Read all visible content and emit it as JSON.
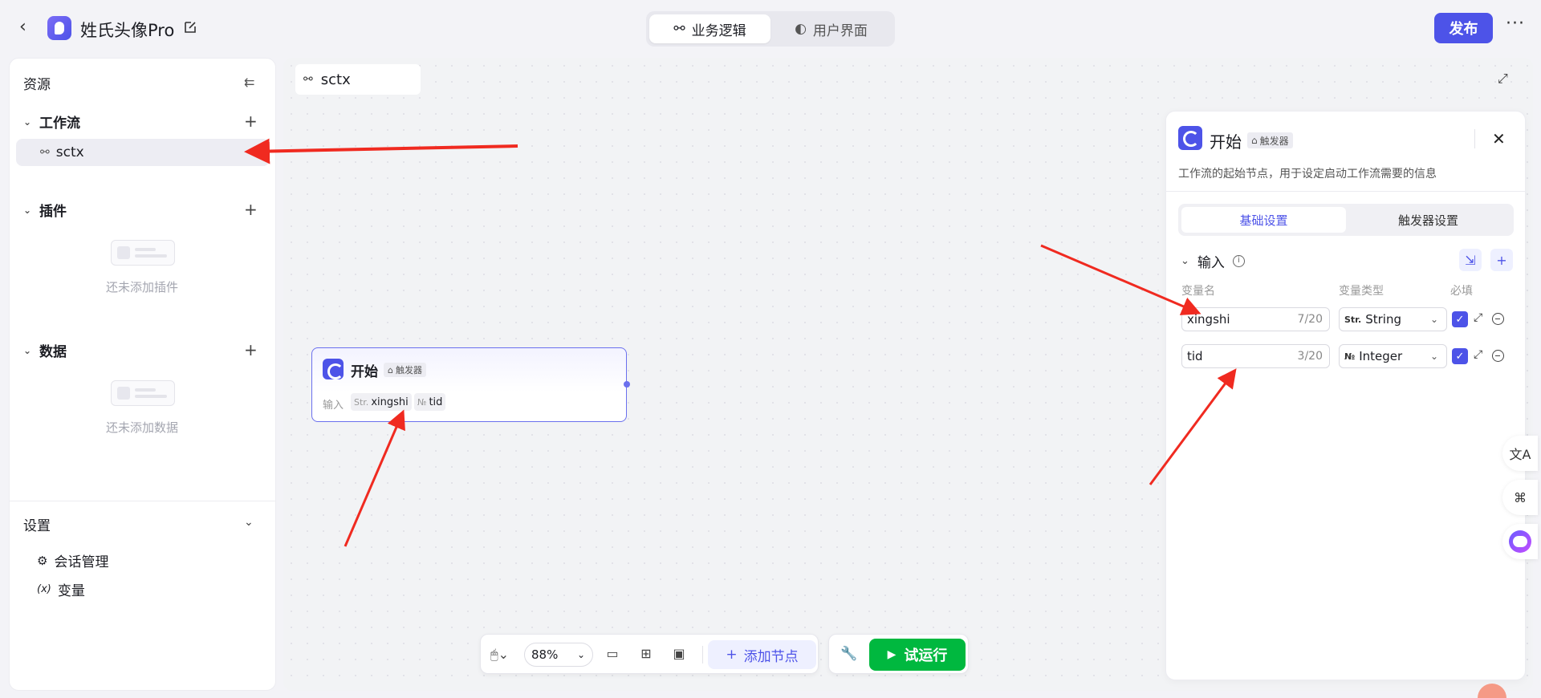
{
  "header": {
    "app_title": "姓氏头像Pro",
    "tabs": [
      {
        "label": "业务逻辑",
        "active": true
      },
      {
        "label": "用户界面",
        "active": false
      }
    ],
    "publish_label": "发布",
    "more_label": "···"
  },
  "sidebar": {
    "title": "资源",
    "groups": {
      "workflow": {
        "label": "工作流",
        "items": [
          "sctx"
        ]
      },
      "plugin": {
        "label": "插件",
        "empty": "还未添加插件"
      },
      "data": {
        "label": "数据",
        "empty": "还未添加数据"
      }
    },
    "settings": {
      "label": "设置",
      "items": [
        {
          "label": "会话管理",
          "icon": "chat-settings-icon"
        },
        {
          "label": "变量",
          "icon": "variable-icon"
        }
      ]
    }
  },
  "canvas": {
    "workflow_tab": "sctx",
    "start_node": {
      "title": "开始",
      "tag": "触发器",
      "input_label": "输入",
      "params": [
        {
          "type": "Str.",
          "name": "xingshi"
        },
        {
          "type": "№",
          "name": "tid"
        }
      ]
    }
  },
  "panel": {
    "title": "开始",
    "tag": "触发器",
    "description": "工作流的起始节点，用于设定启动工作流需要的信息",
    "tabs": [
      {
        "label": "基础设置",
        "active": true
      },
      {
        "label": "触发器设置",
        "active": false
      }
    ],
    "section_label": "输入",
    "columns": {
      "name": "变量名",
      "type": "变量类型",
      "required": "必填"
    },
    "rows": [
      {
        "name": "xingshi",
        "count": "7/20",
        "type_icon": "Str.",
        "type": "String",
        "required": true
      },
      {
        "name": "tid",
        "count": "3/20",
        "type_icon": "№",
        "type": "Integer",
        "required": true
      }
    ]
  },
  "toolbar": {
    "zoom": "88%",
    "add_node_label": "添加节点",
    "run_label": "试运行"
  },
  "colors": {
    "brand": "#4d53e8",
    "run": "#00b83f",
    "annotation_arrow": "#f02a20"
  }
}
